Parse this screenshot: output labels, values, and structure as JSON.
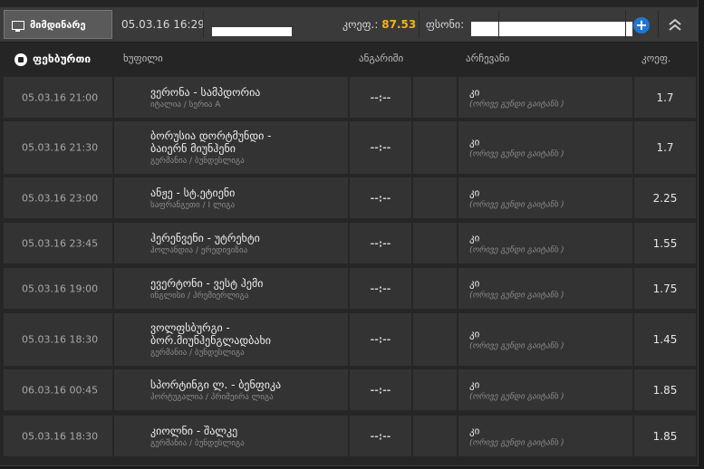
{
  "topbar": {
    "live_label": "მიმდინარე",
    "datetime": "05.03.16 16:29",
    "coef_label": "კოეფ.:",
    "coef_value": "87.53",
    "fund_label": "ფსონი:",
    "add_icon": "plus-circle-icon",
    "collapse_icon": "double-chevron-up-icon"
  },
  "header": {
    "sport": "ფეხბურთი",
    "col_event": "ხუფილი",
    "col_score": "ანგარიში",
    "col_pick": "არჩევანი",
    "col_odds": "კოეფ."
  },
  "rows": [
    {
      "time": "05.03.16 21:00",
      "match": "ვერონა - სამპდორია",
      "league": "იტალია / სერია A",
      "score": "--:--",
      "pick": "კი",
      "pick_desc": "(ორივე გუნდი გაიტანს )",
      "odds": "1.7"
    },
    {
      "time": "05.03.16 21:30",
      "match": "ბორუსია დორტმუნდი - ბაიერნ მიუნჰენი",
      "league": "გერმანია / ბუნდესლიგა",
      "score": "--:--",
      "pick": "კი",
      "pick_desc": "(ორივე გუნდი გაიტანს )",
      "odds": "1.7"
    },
    {
      "time": "05.03.16 23:00",
      "match": "ანჟე - სტ.ეტიენი",
      "league": "საფრანგეთი / I ლიგა",
      "score": "--:--",
      "pick": "კი",
      "pick_desc": "(ორივე გუნდი გაიტანს )",
      "odds": "2.25"
    },
    {
      "time": "05.03.16 23:45",
      "match": "ჰერენვენი - უტრეხტი",
      "league": "ჰოლანდია / ერედივიზია",
      "score": "--:--",
      "pick": "კი",
      "pick_desc": "(ორივე გუნდი გაიტანს )",
      "odds": "1.55"
    },
    {
      "time": "05.03.16 19:00",
      "match": "ევერტონი - ვესტ ჰემი",
      "league": "ინგლისი / პრემიერლიგა",
      "score": "--:--",
      "pick": "კი",
      "pick_desc": "(ორივე გუნდი გაიტანს )",
      "odds": "1.75"
    },
    {
      "time": "05.03.16 18:30",
      "match": "ვოლფსბურგი - ბორ.მიუნჰენგლადბახი",
      "league": "გერმანია / ბუნდესლიგა",
      "score": "--:--",
      "pick": "კი",
      "pick_desc": "(ორივე გუნდი გაიტანს )",
      "odds": "1.45"
    },
    {
      "time": "06.03.16 00:45",
      "match": "სპორტინგი ლ. - ბენფიკა",
      "league": "პორტუგალია / პრიმეირა ლიგა",
      "score": "--:--",
      "pick": "კი",
      "pick_desc": "(ორივე გუნდი გაიტანს )",
      "odds": "1.85"
    },
    {
      "time": "05.03.16 18:30",
      "match": "კიოლნი - შალკე",
      "league": "გერმანია / ბუნდესლიგა",
      "score": "--:--",
      "pick": "კი",
      "pick_desc": "(ორივე გუნდი გაიტანს )",
      "odds": "1.85"
    }
  ]
}
